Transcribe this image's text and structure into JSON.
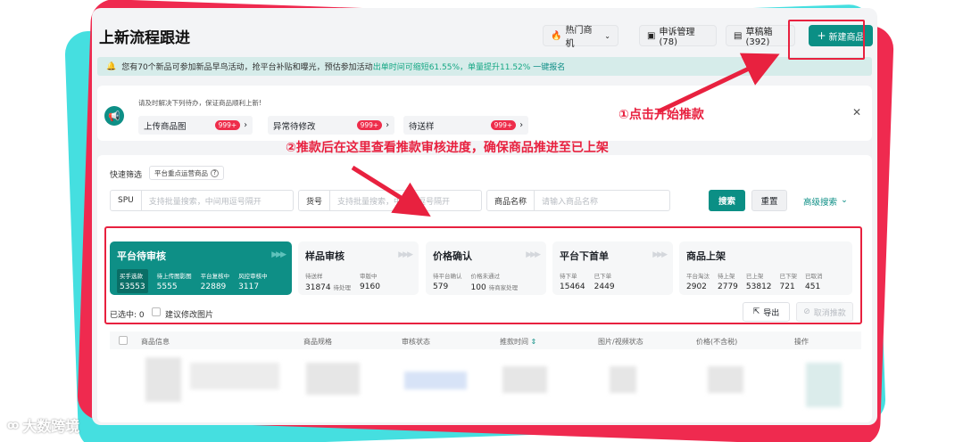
{
  "header": {
    "title": "上新流程跟进",
    "hot_label": "热门商机",
    "appeal_label": "申诉管理 (78)",
    "draft_label": "草稿箱 (392)",
    "new_label": "新建商品"
  },
  "notice": {
    "text1": "您有70个新品可参加新品早鸟活动，抢平台补贴和曝光，预估参加活动",
    "highlight": "出单时间可缩短61.55%，单量提升11.52%",
    "link": "一键报名"
  },
  "todo": {
    "hint": "请及时解决下列待办，保证商品顺利上新!",
    "tabs": [
      {
        "label": "上传商品图",
        "badge": "999+"
      },
      {
        "label": "异常待修改",
        "badge": "999+"
      },
      {
        "label": "待送样",
        "badge": "999+"
      }
    ]
  },
  "annotations": {
    "step1": "①点击开始推款",
    "step2": "②推款后在这里查看推款审核进度，确保商品推进至已上架"
  },
  "filter": {
    "quick_label": "快速筛选",
    "quick_tag": "平台重点运营商品",
    "spu_label": "SPU",
    "spu_placeholder": "支持批量搜索，中间用逗号隔开",
    "item_label": "货号",
    "item_placeholder": "支持批量搜索，中间用逗号隔开",
    "name_label": "商品名称",
    "name_placeholder": "请输入商品名称",
    "search": "搜索",
    "reset": "重置",
    "advanced": "高级搜索"
  },
  "stages": [
    {
      "name": "平台待审核",
      "stats": [
        {
          "k": "买手选款",
          "v": "53553"
        },
        {
          "k": "待上传图影图",
          "v": "5555"
        },
        {
          "k": "平台复核中",
          "v": "22889"
        },
        {
          "k": "风控审核中",
          "v": "3117"
        }
      ]
    },
    {
      "name": "样品审核",
      "stats": [
        {
          "k": "待送样",
          "v": "31874",
          "s": "待处理"
        },
        {
          "k": "审版中",
          "v": "9160"
        }
      ]
    },
    {
      "name": "价格确认",
      "stats": [
        {
          "k": "待平台确认",
          "v": "579"
        },
        {
          "k": "价格未通过",
          "v": "100",
          "s": "待商家处理"
        }
      ]
    },
    {
      "name": "平台下首单",
      "stats": [
        {
          "k": "待下单",
          "v": "15464"
        },
        {
          "k": "已下单",
          "v": "2449"
        }
      ]
    },
    {
      "name": "商品上架",
      "stats": [
        {
          "k": "平台淘汰",
          "v": "2902"
        },
        {
          "k": "待上架",
          "v": "2779"
        },
        {
          "k": "已上架",
          "v": "53812"
        },
        {
          "k": "已下架",
          "v": "721"
        },
        {
          "k": "已取消",
          "v": "451"
        }
      ]
    }
  ],
  "bulk": {
    "selected": "已选中: 0",
    "suggest": "建议修改图片",
    "export": "导出",
    "cancel": "取消推款"
  },
  "table": {
    "headers": [
      "商品信息",
      "商品规格",
      "审核状态",
      "推款时间",
      "图片/视频状态",
      "价格(不含税)",
      "操作"
    ]
  },
  "watermark": "大数跨境",
  "colors": {
    "accent": "#0e8f86",
    "annotation": "#e8213f",
    "badge": "#ee2d4b"
  }
}
